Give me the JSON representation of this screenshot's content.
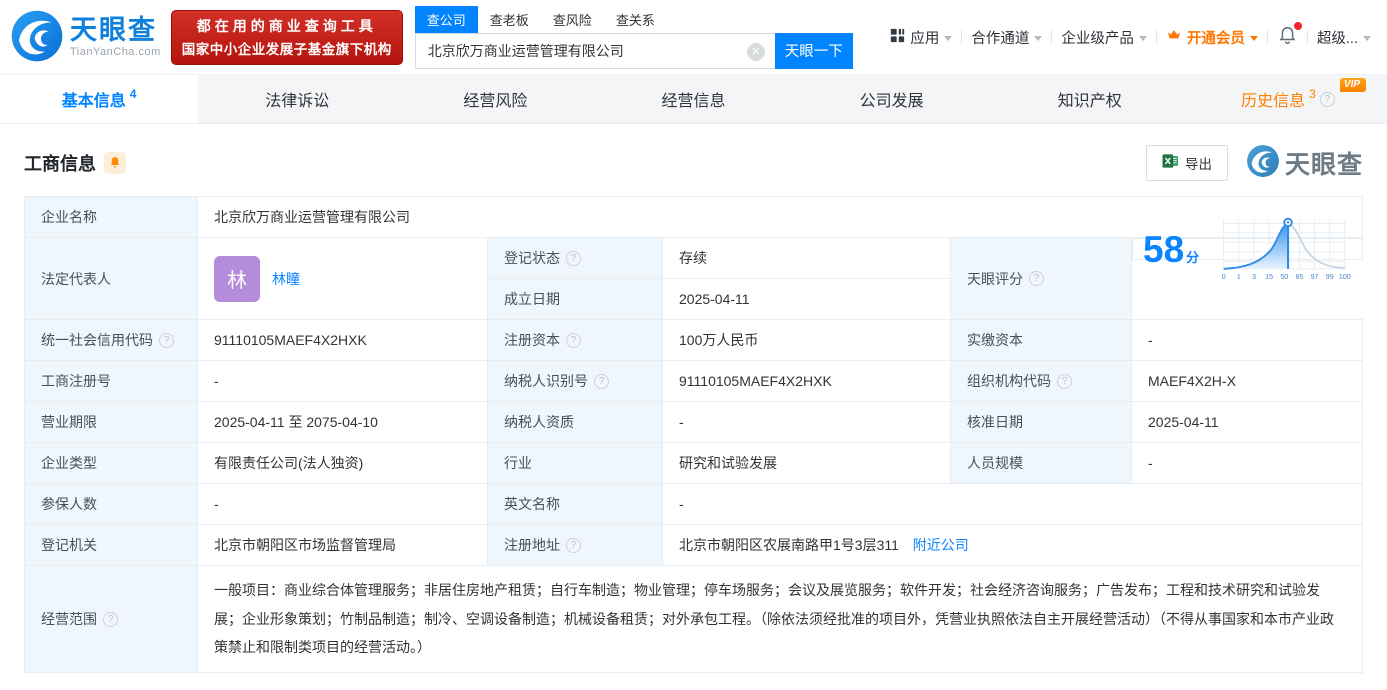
{
  "header": {
    "logo": {
      "title": "天眼查",
      "subtitle": "TianYanCha.com"
    },
    "promo": {
      "line1": "都在用的商业查询工具",
      "line2": "国家中小企业发展子基金旗下机构"
    },
    "search": {
      "tabs": [
        {
          "label": "查公司"
        },
        {
          "label": "查老板"
        },
        {
          "label": "查风险"
        },
        {
          "label": "查关系"
        }
      ],
      "value": "北京欣万商业运营管理有限公司",
      "button": "天眼一下"
    },
    "nav": {
      "apps": "应用",
      "partner": "合作通道",
      "enterprise": "企业级产品",
      "vip": "开通会员",
      "super": "超级..."
    }
  },
  "tabs": [
    {
      "label": "基本信息",
      "count": "4"
    },
    {
      "label": "法律诉讼"
    },
    {
      "label": "经营风险"
    },
    {
      "label": "经营信息"
    },
    {
      "label": "公司发展"
    },
    {
      "label": "知识产权"
    },
    {
      "label": "历史信息",
      "count": "3",
      "badge": "VIP"
    }
  ],
  "section": {
    "title": "工商信息",
    "export": "导出",
    "watermark": "天眼查"
  },
  "info": {
    "company_name": {
      "label": "企业名称",
      "value": "北京欣万商业运营管理有限公司"
    },
    "legal_rep": {
      "label": "法定代表人",
      "avatar": "林",
      "value": "林瞳"
    },
    "reg_status": {
      "label": "登记状态",
      "value": "存续"
    },
    "establish_date": {
      "label": "成立日期",
      "value": "2025-04-11"
    },
    "score": {
      "label": "天眼评分",
      "value": "58",
      "unit": "分"
    },
    "credit_code": {
      "label": "统一社会信用代码",
      "value": "91110105MAEF4X2HXK"
    },
    "reg_capital": {
      "label": "注册资本",
      "value": "100万人民币"
    },
    "paid_capital": {
      "label": "实缴资本",
      "value": "-"
    },
    "reg_number": {
      "label": "工商注册号",
      "value": "-"
    },
    "taxpayer_id": {
      "label": "纳税人识别号",
      "value": "91110105MAEF4X2HXK"
    },
    "org_code": {
      "label": "组织机构代码",
      "value": "MAEF4X2H-X"
    },
    "business_term": {
      "label": "营业期限",
      "value": "2025-04-11 至 2075-04-10"
    },
    "taxpayer_quality": {
      "label": "纳税人资质",
      "value": "-"
    },
    "approval_date": {
      "label": "核准日期",
      "value": "2025-04-11"
    },
    "company_type": {
      "label": "企业类型",
      "value": "有限责任公司(法人独资)"
    },
    "industry": {
      "label": "行业",
      "value": "研究和试验发展"
    },
    "staff_size": {
      "label": "人员规模",
      "value": "-"
    },
    "insured_count": {
      "label": "参保人数",
      "value": "-"
    },
    "english_name": {
      "label": "英文名称",
      "value": "-"
    },
    "reg_authority": {
      "label": "登记机关",
      "value": "北京市朝阳区市场监督管理局"
    },
    "reg_address": {
      "label": "注册地址",
      "value": "北京市朝阳区农展南路甲1号3层311",
      "link": "附近公司"
    },
    "business_scope": {
      "label": "经营范围",
      "value": "一般项目：商业综合体管理服务；非居住房地产租赁；自行车制造；物业管理；停车场服务；会议及展览服务；软件开发；社会经济咨询服务；广告发布；工程和技术研究和试验发展；企业形象策划；竹制品制造；制冷、空调设备制造；机械设备租赁；对外承包工程。（除依法须经批准的项目外，凭营业执照依法自主开展经营活动）（不得从事国家和本市产业政策禁止和限制类项目的经营活动。）"
    }
  },
  "chart_data": {
    "type": "area",
    "title": "天眼评分",
    "score": 58,
    "x_ticks": [
      "0",
      "1",
      "3",
      "15",
      "50",
      "85",
      "97",
      "99",
      "100"
    ]
  },
  "colors": {
    "accent": "#0084ff",
    "orange": "#ff8000",
    "green": "#2bb24c",
    "brand_red": "#c0211b",
    "link": "#0b85ff"
  }
}
